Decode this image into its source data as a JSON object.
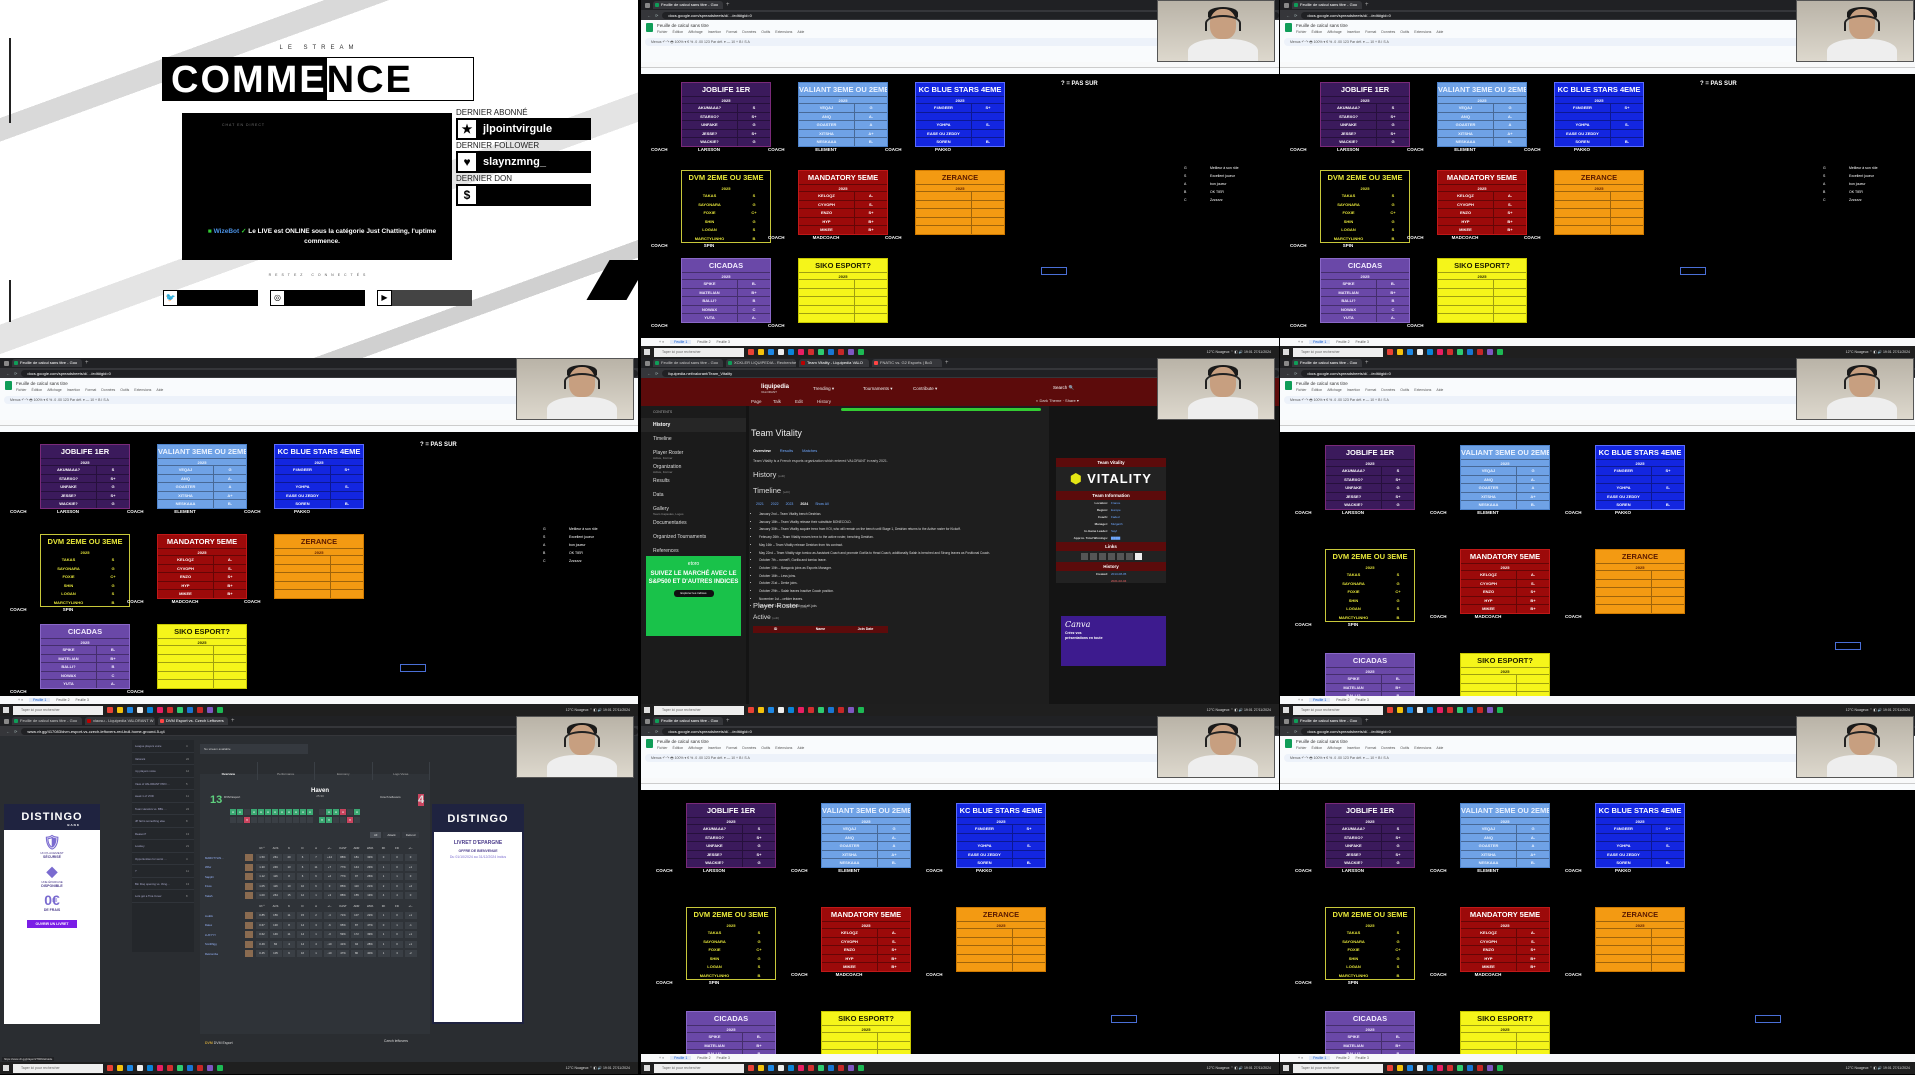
{
  "layout": "3x3 grid of stream frames",
  "stream_overlay": {
    "subtitle": "LE STREAM",
    "title_dark": "COMME",
    "title_light": "NCE",
    "chat_header": "CHAT EN DIRECT",
    "chat_bot": "WizeBot",
    "chat_message": "Le LIVE est ONLINE sous la catégorie Just Chatting, l'uptime commence.",
    "stats": [
      {
        "label": "DERNIER ABONNÉ",
        "icon": "star-icon",
        "glyph": "★",
        "value": "jlpointvirgule"
      },
      {
        "label": "DERNIER FOLLOWER",
        "icon": "heart-icon",
        "glyph": "♥",
        "value": "slaynzmng_"
      },
      {
        "label": "DERNIER DON",
        "icon": "dollar-icon",
        "glyph": "$",
        "value": ""
      }
    ],
    "connect_label": "RESTEZ CONNECTÉS",
    "socials": [
      {
        "icon": "twitter-icon",
        "glyph": "🐦"
      },
      {
        "icon": "instagram-icon",
        "glyph": "◎"
      },
      {
        "icon": "youtube-icon",
        "glyph": "▶"
      }
    ]
  },
  "sheets": {
    "tab_title": "Feuille de calcul sans titre - Goo",
    "doc_title": "Feuille de calcul sans titre",
    "url": "docs.google.com/spreadsheets/d/…/edit#gid=0",
    "url_domain": "docs.google.com",
    "menu": [
      "Fichier",
      "Édition",
      "Affichage",
      "Insertion",
      "Format",
      "Données",
      "Outils",
      "Extensions",
      "Aide"
    ],
    "toolbar_text": "Menus  ↶ ↷ 🖶  100% ▾  €  %  .0  .00  123  Par déf. ▾  —  10  +  B  I  S  A",
    "sheet_tabs": [
      "Feuille 1",
      "Feuille 2",
      "Feuille 3"
    ],
    "note": "? = PAS SUR",
    "coach_label": "COACH",
    "legend": [
      {
        "grade": "G",
        "meaning": "Meilleur à son rôle"
      },
      {
        "grade": "S",
        "meaning": "Excellent joueur"
      },
      {
        "grade": "A",
        "meaning": "bon joueur"
      },
      {
        "grade": "B",
        "meaning": "OK TIER"
      },
      {
        "grade": "C",
        "meaning": "Zzzzzzz"
      }
    ],
    "teams": [
      {
        "name": "JOBLIFE 1ER",
        "year": "2025",
        "bg": "#3b1a5c",
        "fg": "#ffffff",
        "border": "#7a2a7a",
        "players": [
          [
            "AKUMAAA?",
            "S"
          ],
          [
            "STARXO?",
            "S+"
          ],
          [
            "UNFAKE",
            "G"
          ],
          [
            "JESSE?",
            "S+"
          ],
          [
            "WACKIE?",
            "G"
          ]
        ],
        "coach": "LARSSON"
      },
      {
        "name": "VALIANT 3EME OU 2EME",
        "year": "2025",
        "bg": "#6fa2e6",
        "fg": "#eaf2ff",
        "border": "#4f84cc",
        "players": [
          [
            "VEQAJ",
            "G"
          ],
          [
            "ANQ",
            "A-"
          ],
          [
            "GOASTER",
            "A"
          ],
          [
            "XITSHA",
            "A+"
          ],
          [
            "NESKAAA",
            "B-"
          ]
        ],
        "coach": "ELEMENT"
      },
      {
        "name": "KC BLUE STARS 4EME",
        "year": "2025",
        "bg": "#1326e0",
        "fg": "#ffffff",
        "border": "#5a6cff",
        "players": [
          [
            "F4NGEER",
            "S+"
          ],
          [
            "",
            ""
          ],
          [
            "YOHPA",
            "S-"
          ],
          [
            "EASE OU ZEDDY",
            ""
          ],
          [
            "SOREN",
            "B-"
          ]
        ],
        "coach": "PAKKO"
      },
      {
        "name": "DVM 2EME OU 3EME",
        "year": "2025",
        "bg": "#000000",
        "fg": "#e6e63a",
        "border": "#c8c83a",
        "players": [
          [
            "TAKAS",
            "S"
          ],
          [
            "SAYONARA",
            "G"
          ],
          [
            "FOXIE",
            "C+"
          ],
          [
            "SHIN",
            "G"
          ],
          [
            "LOGAN",
            "S"
          ],
          [
            "MARCTYLINHO",
            "B"
          ]
        ],
        "coach": "SPIN"
      },
      {
        "name": "MANDATORY 5EME",
        "year": "2025",
        "bg": "#9c0a0a",
        "fg": "#ffffff",
        "border": "#c01818",
        "players": [
          [
            "KELOQZ",
            "A-"
          ],
          [
            "CYVOPH",
            "S-"
          ],
          [
            "ENZO",
            "S+"
          ],
          [
            "HYP",
            "B+"
          ],
          [
            "MIKEE",
            "B+"
          ]
        ],
        "coach": "MADCOACH"
      },
      {
        "name": "ZERANCE",
        "year": "2025",
        "bg": "#f39a12",
        "fg": "#5a1a00",
        "border": "#d07a00",
        "players": [
          [
            "",
            ""
          ],
          [
            "",
            ""
          ],
          [
            "",
            ""
          ],
          [
            "",
            ""
          ],
          [
            "",
            ""
          ]
        ],
        "coach": ""
      },
      {
        "name": "CICADAS",
        "year": "2025",
        "bg": "#6a48a8",
        "fg": "#f3ecff",
        "border": "#8a68c8",
        "players": [
          [
            "SPIKE",
            "B-"
          ],
          [
            "MATELIAN",
            "B+"
          ],
          [
            "BALLI?",
            "B"
          ],
          [
            "NOWAX",
            "C"
          ],
          [
            "YUTA",
            "A-"
          ]
        ],
        "coach": ""
      },
      {
        "name": "SIKO ESPORT?",
        "year": "2025",
        "bg": "#f5f51a",
        "fg": "#222200",
        "border": "#c8c800",
        "players": [
          [
            "",
            ""
          ],
          [
            "",
            ""
          ],
          [
            "",
            ""
          ],
          [
            "",
            ""
          ],
          [
            "",
            ""
          ]
        ],
        "coach": ""
      }
    ]
  },
  "taskbar": {
    "search_placeholder": "Taper ici pour rechercher",
    "weather": "12°C Nuageux",
    "tray_record": "Prêt du record",
    "time": "19:01",
    "date": "27/11/2024"
  },
  "liquipedia": {
    "tabs": [
      "Feuille de calcul sans titre - Goo",
      "XCKLER LIQUIPEDIA - Recherche",
      "Team Vitality - Liquipedia VALO",
      "FNATIC vs. G2 Esports | Bo3"
    ],
    "url": "liquipedia.net/valorant/Team_Vitality",
    "url_domain": "liquipedia.net",
    "brand": "liquipedia",
    "brand_sub": "VALORANT",
    "nav": [
      "Trending ▾",
      "Tournaments ▾",
      "Contribute ▾"
    ],
    "subnav": [
      "Page",
      "Talk",
      "Edit",
      "History"
    ],
    "search_label": "Search",
    "dark_theme_label": "Dark Theme",
    "share_label": "Share ▾",
    "sidebar_header": "CONTENTS",
    "sidebar": [
      {
        "label": "History",
        "active": true
      },
      {
        "label": "Timeline",
        "sub": ""
      },
      {
        "label": "Player Roster",
        "sub": "Active, Former"
      },
      {
        "label": "Organization",
        "sub": "Active, Former"
      },
      {
        "label": "Results",
        "sub": ""
      },
      {
        "label": "Data",
        "sub": ""
      },
      {
        "label": "Gallery",
        "sub": "Team Capsules, Logos"
      },
      {
        "label": "Documentaries",
        "sub": ""
      },
      {
        "label": "Organized Tournaments",
        "sub": ""
      },
      {
        "label": "References",
        "sub": ""
      }
    ],
    "ad_text": "SUIVEZ LE MARCHÉ AVEC LE S&P500 ET D'AUTRES INDICES",
    "ad_brand": "etoro",
    "ad_button": "Explorer les indices",
    "page_title": "Team Vitality",
    "page_tabs": [
      "Overview",
      "Results",
      "Matches"
    ],
    "intro": "Team Vitality is a French esports organization which entered VALORANT in early 2021.",
    "h_history": "History",
    "h_timeline": "Timeline",
    "edit_label": "[edit]",
    "years": [
      "2021",
      "2022",
      "2023",
      "2024",
      "Show All"
    ],
    "active_year": "2024",
    "timeline": [
      "January 2nd – Team Vitality bench Destrian.",
      "January 18th – Team Vitality release their substitute BONECOLD.",
      "January 30th – Team Vitality acquire trexx from KOI, who will remain on the bench until Stage 1, Destrian returns to the Active roster for Kickoff.",
      "February 26th – Team Vitality moves trexx to the active roster, benching Destrian.",
      "May 16th – Team Vitality release Destrian from his contract.",
      "May 22nd – Team Vitality sign tomioc as Assistant Coach and promote Gorilla to Head Coach, additionally Salah is benched and Strong leaves as Positional Coach.",
      "October 7th – runneR, Gorilla and tomioc leave.",
      "October 10th – Bangovic joins as Esports Manager.",
      "October 16th – Less joins.",
      "October 21st – Derke joins.",
      "October 29th – Salah leaves Inactive Coach position.",
      "November 1st – cefider leaves.",
      "November 14th – Faded and maLeK join."
    ],
    "h_roster": "Player Roster",
    "h_active": "Active",
    "roster_cols": [
      "ID",
      "Name",
      "Join Date"
    ],
    "infobox": {
      "title": "Team Vitality",
      "logo_text": "VITALITY",
      "section_info": "Team Information",
      "rows": [
        [
          "Location:",
          "France"
        ],
        [
          "Region:",
          "Europe"
        ],
        [
          "Coach:",
          "Faded"
        ],
        [
          "Manager:",
          "Mulgarth"
        ],
        [
          "In-Game Leader:",
          "Sayf"
        ],
        [
          "Approx. Total Winnings:",
          "▇▇▇▇"
        ]
      ],
      "section_links": "Links",
      "section_history": "History",
      "created_label": "Created:",
      "created": [
        "2013-08-05",
        "2021-02-04"
      ]
    },
    "canva_ad": {
      "brand": "Canva",
      "text": "Créez vos présentations en toute"
    }
  },
  "vlr": {
    "tabs": [
      "Feuille de calcul sans titre - Goo",
      "xiaosu - Liquipedia VALORANT W",
      "DVM Esport vs. Czech Leftovers"
    ],
    "url": "www.vlr.gg/417083/dvm-esport-vs-czech-leftovers-red-bull-home-ground-5-q4",
    "url_domain": "www.vlr.gg",
    "stream_label": "No stream available",
    "ad_brand": "DISTINGO",
    "ad_sub": "BANK",
    "ad_features": [
      {
        "glyph": "🛡",
        "small": "UN PLACEMENT",
        "big": "SÉCURISÉ"
      },
      {
        "glyph": "◆",
        "small": "UNE ÉPARGNE",
        "big": "DISPONIBLE"
      },
      {
        "glyph": "0€",
        "small": "",
        "big": "DE FRAIS"
      }
    ],
    "ad_button": "OUVRIR UN LIVRET",
    "ad2_title": "LIVRET D'EPARGNE",
    "ad2_offer": "OFFRE DE BIENVENUE",
    "ad2_dates": "Du 01/10/2024 au 31/12/2024 inclus",
    "threads": [
      [
        "League players voice",
        "4"
      ],
      [
        "Valorant",
        "22"
      ],
      [
        "my players voice",
        "12"
      ],
      [
        "View of VALORANT PRO …",
        "5"
      ],
      [
        "week 1 of VOD",
        "11"
      ],
      [
        "Team Heretics vs. BBL …",
        "24"
      ],
      [
        "JP fail is something else",
        "8"
      ],
      [
        "Reason?",
        "13"
      ],
      [
        "Lowkey",
        "21"
      ],
      [
        "Opportunities for worst …",
        "4"
      ],
      [
        "?",
        "11"
      ],
      [
        "Bin Fisq opening vs. thing…",
        "13"
      ],
      [
        "Lots got a Tina Cover",
        "8"
      ]
    ],
    "match_tabs": [
      "Overview",
      "Performance",
      "Economy",
      "Logs Views"
    ],
    "team1": {
      "name": "DVM Esport",
      "score": "13",
      "sub": "13 / 1"
    },
    "team2": {
      "name": "Czech leftovers",
      "score": "4",
      "sub": "2 / 2"
    },
    "map": "Haven",
    "map_time": "25:30",
    "rounds_t1": [
      "W",
      "W",
      "L",
      "W",
      "W",
      "W",
      "W",
      "W",
      "W",
      "W",
      "W",
      "W",
      "L",
      "W",
      "W",
      "R",
      "L",
      "W"
    ],
    "rounds_t2": [
      "L",
      "L",
      "R",
      "L",
      "L",
      "L",
      "L",
      "L",
      "L",
      "L",
      "L",
      "L",
      "W",
      "W",
      "L",
      "L",
      "R",
      "L"
    ],
    "filter": [
      "All",
      "Attack",
      "Defend"
    ],
    "stat_cols": [
      "R²·⁰",
      "ACS",
      "K",
      "D",
      "A",
      "+/–",
      "KAST",
      "ADR",
      "HS%",
      "FK",
      "FD",
      "+/–"
    ],
    "team1_players": [
      {
        "name": "MARCTYLIN…",
        "team": "DVM",
        "stats": [
          "1.50",
          "261",
          "20",
          "6",
          "7",
          "+14",
          "88%",
          "181",
          "33%",
          "0",
          "0",
          "0"
        ]
      },
      {
        "name": "Wrlw",
        "team": "DVM",
        "stats": [
          "1.30",
          "246",
          "13",
          "6",
          "11",
          "+7",
          "77%",
          "144",
          "23%",
          "1",
          "0",
          "+1"
        ]
      },
      {
        "name": "Sapphi",
        "team": "DVM",
        "stats": [
          "1.12",
          "116",
          "8",
          "6",
          "6",
          "+2",
          "77%",
          "97",
          "26%",
          "1",
          "1",
          "0"
        ]
      },
      {
        "name": "Fixos",
        "team": "DVM",
        "stats": [
          "1.05",
          "116",
          "10",
          "10",
          "6",
          "0",
          "85%",
          "110",
          "21%",
          "2",
          "0",
          "+2"
        ]
      },
      {
        "name": "Takah",
        "team": "DVM",
        "stats": [
          "1.00",
          "264",
          "15",
          "12",
          "1",
          "+3",
          "88%",
          "155",
          "13%",
          "4",
          "4",
          "0"
        ]
      }
    ],
    "team2_players": [
      {
        "name": "zeuRo",
        "team": "CZEC",
        "stats": [
          "0.85",
          "156",
          "11",
          "15",
          "2",
          "-4",
          "71%",
          "107",
          "22%",
          "1",
          "0",
          "+1"
        ]
      },
      {
        "name": "Dalex",
        "team": "CZEC",
        "stats": [
          "0.67",
          "130",
          "8",
          "14",
          "3",
          "-6",
          "65%",
          "87",
          "47%",
          "0",
          "1",
          "-1"
        ]
      },
      {
        "name": "LUKYYY",
        "team": "CZEC",
        "stats": [
          "0.62",
          "146",
          "11",
          "14",
          "1",
          "-3",
          "59%",
          "172",
          "39%",
          "1",
          "0",
          "+1"
        ]
      },
      {
        "name": "Smithfigg",
        "team": "CZEC",
        "stats": [
          "0.49",
          "84",
          "4",
          "14",
          "4",
          "-10",
          "41%",
          "94",
          "28%",
          "1",
          "0",
          "+1"
        ]
      },
      {
        "name": "Rekromba",
        "team": "CZEC",
        "stats": [
          "0.45",
          "105",
          "6",
          "16",
          "1",
          "-10",
          "47%",
          "80",
          "40%",
          "1",
          "3",
          "-2"
        ]
      }
    ],
    "foot_t1": "DVM Esport",
    "foot_t2": "Czech leftovers",
    "status_url": "https://www.vlr.gg/player/27909/alcaide"
  }
}
